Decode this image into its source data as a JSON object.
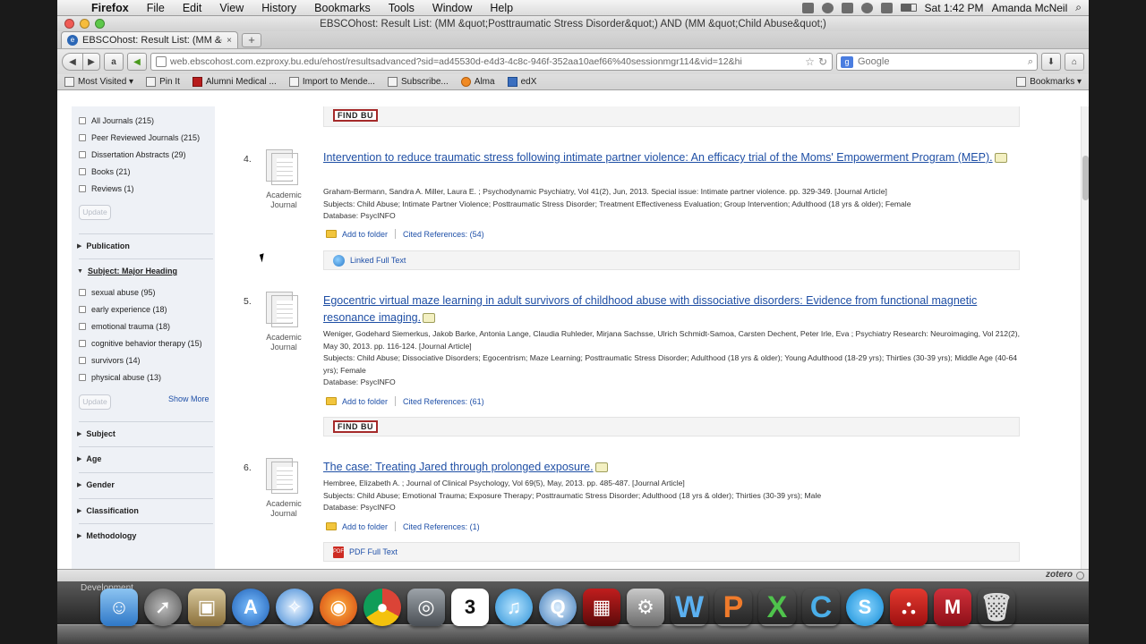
{
  "menubar": {
    "app": "Firefox",
    "items": [
      "File",
      "Edit",
      "View",
      "History",
      "Bookmarks",
      "Tools",
      "Window",
      "Help"
    ],
    "clock": "Sat 1:42 PM",
    "user": "Amanda McNeil"
  },
  "window": {
    "title": "EBSCOhost: Result List: (MM &quot;Posttraumatic Stress Disorder&quot;) AND (MM &quot;Child Abuse&quot;)"
  },
  "tab": {
    "label": "EBSCOhost: Result List: (MM &q...",
    "close": "×",
    "new": "+"
  },
  "nav": {
    "url": "web.ebscohost.com.ezproxy.bu.edu/ehost/resultsadvanced?sid=ad45530d-e4d3-4c8c-946f-352aa10aef66%40sessionmgr114&vid=12&hi",
    "search_placeholder": "Google"
  },
  "bookmarks": {
    "items": [
      "Most Visited ▾",
      "Pin It",
      "Alumni Medical ...",
      "Import to Mende...",
      "Subscribe...",
      "Alma",
      "edX"
    ],
    "right": "Bookmarks ▾"
  },
  "sidebar": {
    "source_types": [
      "All Journals (215)",
      "Peer Reviewed Journals (215)",
      "Dissertation Abstracts (29)",
      "Books (21)",
      "Reviews (1)"
    ],
    "update_label": "Update",
    "publication": "Publication",
    "subject_major": "Subject: Major Heading",
    "subjects": [
      "sexual abuse (95)",
      "early experience (18)",
      "emotional trauma (18)",
      "cognitive behavior therapy (15)",
      "survivors (14)",
      "physical abuse (13)"
    ],
    "show_more": "Show More",
    "facets": [
      "Subject",
      "Age",
      "Gender",
      "Classification",
      "Methodology"
    ]
  },
  "results": {
    "findbu": "FIND BU",
    "add_to_folder": "Add to folder",
    "type_line1": "Academic",
    "type_line2": "Journal",
    "items": [
      {
        "num": "4.",
        "title": "Intervention to reduce traumatic stress following intimate partner violence: An efficacy trial of the Moms' Empowerment Program (MEP).",
        "authors": "Graham-Bermann, Sandra A. Miller, Laura E. ; Psychodynamic Psychiatry, Vol 41(2), Jun, 2013. Special issue: Intimate partner violence. pp. 329-349. [Journal Article]",
        "subjects": "Subjects: Child Abuse; Intimate Partner Violence; Posttraumatic Stress Disorder; Treatment Effectiveness Evaluation; Group Intervention; Adulthood (18 yrs & older); Female",
        "database": "Database: PsycINFO",
        "cited": "Cited References: (54)",
        "fulltext": "Linked Full Text"
      },
      {
        "num": "5.",
        "title": "Egocentric virtual maze learning in adult survivors of childhood abuse with dissociative disorders: Evidence from functional magnetic resonance imaging.",
        "authors": "Weniger, Godehard Siemerkus, Jakob Barke, Antonia Lange, Claudia Ruhleder, Mirjana Sachsse, Ulrich Schmidt-Samoa, Carsten Dechent, Peter Irle, Eva ; Psychiatry Research: Neuroimaging, Vol 212(2), May 30, 2013. pp. 116-124. [Journal Article]",
        "subjects": "Subjects: Child Abuse; Dissociative Disorders; Egocentrism; Maze Learning; Posttraumatic Stress Disorder; Adulthood (18 yrs & older); Young Adulthood (18-29 yrs); Thirties (30-39 yrs); Middle Age (40-64 yrs); Female",
        "database": "Database: PsycINFO",
        "cited": "Cited References: (61)"
      },
      {
        "num": "6.",
        "title": "The case: Treating Jared through prolonged exposure.",
        "authors": "Hembree, Elizabeth A. ; Journal of Clinical Psychology, Vol 69(5), May, 2013. pp. 485-487. [Journal Article]",
        "subjects": "Subjects: Child Abuse; Emotional Trauma; Exposure Therapy; Posttraumatic Stress Disorder; Adulthood (18 yrs & older); Thirties (30-39 yrs); Male",
        "database": "Database: PsycINFO",
        "cited": "Cited References: (1)",
        "fulltext": "PDF Full Text"
      }
    ]
  },
  "statusbar": {
    "zotero": "zotero"
  },
  "dock": {
    "label": "Development",
    "calendar_day": "3",
    "icons": [
      "finder-icon",
      "launchpad-icon",
      "preview-icon",
      "app-store-icon",
      "safari-icon",
      "firefox-icon",
      "chrome-icon",
      "facetime-icon",
      "calendar-icon",
      "itunes-icon",
      "quicktime-icon",
      "photo-booth-icon",
      "system-preferences-icon",
      "word-icon",
      "powerpoint-icon",
      "excel-icon",
      "citrix-icon",
      "skype-icon",
      "acrobat-icon",
      "mendeley-icon",
      "trash-icon"
    ]
  }
}
